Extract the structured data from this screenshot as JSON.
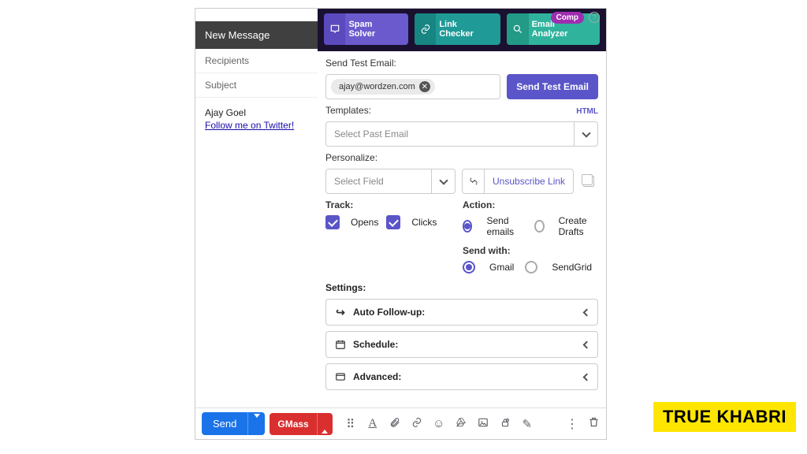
{
  "sidebar": {
    "new_message": "New Message",
    "recipients": "Recipients",
    "subject": "Subject",
    "sig_name": "Ajay Goel",
    "sig_link": "Follow me on Twitter!"
  },
  "topbar": {
    "comp": "Comp",
    "spam_solver": "Spam Solver",
    "link_checker": "Link Checker",
    "email_analyzer": "Email Analyzer"
  },
  "test": {
    "label": "Send Test Email:",
    "chip": "ajay@wordzen.com",
    "button": "Send Test Email"
  },
  "templates": {
    "label": "Templates:",
    "html": "HTML",
    "placeholder": "Select Past Email"
  },
  "personalize": {
    "label": "Personalize:",
    "placeholder": "Select Field",
    "unsubscribe": "Unsubscribe Link"
  },
  "track": {
    "label": "Track:",
    "opens": "Opens",
    "clicks": "Clicks"
  },
  "action": {
    "label": "Action:",
    "send": "Send emails",
    "drafts": "Create Drafts",
    "sendwith_label": "Send with:",
    "gmail": "Gmail",
    "sendgrid": "SendGrid"
  },
  "settings": {
    "label": "Settings:",
    "followup": "Auto Follow-up:",
    "schedule": "Schedule:",
    "advanced": "Advanced:"
  },
  "bottom": {
    "send": "Send",
    "gmass": "GMass"
  },
  "watermark": "TRUE KHABRI"
}
